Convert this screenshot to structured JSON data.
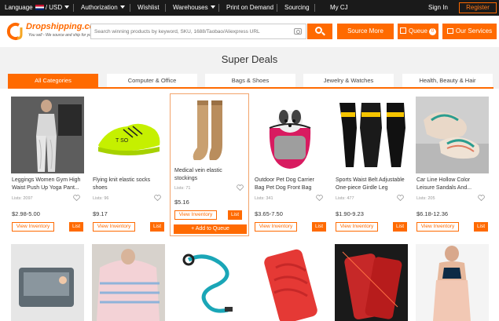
{
  "topbar": {
    "language": "Language",
    "currency": "/ USD",
    "authorization": "Authorization",
    "wishlist": "Wishlist",
    "warehouses": "Warehouses",
    "print_on_demand": "Print on Demand",
    "sourcing": "Sourcing",
    "my_cj": "My CJ",
    "sign_in": "Sign In",
    "register": "Register"
  },
  "header": {
    "logo_text": "Dropshipping.com",
    "logo_tagline": "You sell - We source and ship for you!",
    "search_placeholder": "Search winning products by keyword, SKU, 1688/Taobao/Aliexpress URL",
    "source_more": "Source More",
    "queue": "Queue",
    "queue_count": "0",
    "our_services": "Our Services"
  },
  "page": {
    "title": "Super Deals"
  },
  "tabs": [
    {
      "label": "All Categories",
      "active": true
    },
    {
      "label": "Computer & Office",
      "active": false
    },
    {
      "label": "Bags & Shoes",
      "active": false
    },
    {
      "label": "Jewelry & Watches",
      "active": false
    },
    {
      "label": "Health, Beauty & Hair",
      "active": false
    }
  ],
  "products": [
    {
      "name": "Leggings Women Gym High Waist Push Up Yoga Pant...",
      "lists": "Lists: 2097",
      "price": "$2.98-5.00",
      "image": "leggings-photo"
    },
    {
      "name": "Flying knit elastic socks shoes",
      "lists": "Lists: 96",
      "price": "$9.17",
      "image": "green-sneaker-photo"
    },
    {
      "name": "Medical vein elastic stockings",
      "lists": "Lists: 71",
      "price": "$5.16",
      "image": "stockings-photo"
    },
    {
      "name": "Outdoor Pet Dog Carrier Bag Pet Dog Front Bag",
      "lists": "Lists: 341",
      "price": "$3.65-7.50",
      "image": "dog-carrier-photo"
    },
    {
      "name": "Sports Waist Belt Adjustable One-piece Girdle Leg Straps",
      "lists": "Lists: 477",
      "price": "$1.90-9.23",
      "image": "girdle-photo"
    },
    {
      "name": "Car Line Hollow Color Leisure Sandals And...",
      "lists": "Lists: 205",
      "price": "$6.18-12.36",
      "image": "sandals-photo"
    }
  ],
  "actions": {
    "view_inventory": "View Inventory",
    "list": "List",
    "add_to_queue": "+ Add to Queue"
  },
  "colors": {
    "accent": "#ff6a00",
    "topbar": "#1a1a1a"
  }
}
